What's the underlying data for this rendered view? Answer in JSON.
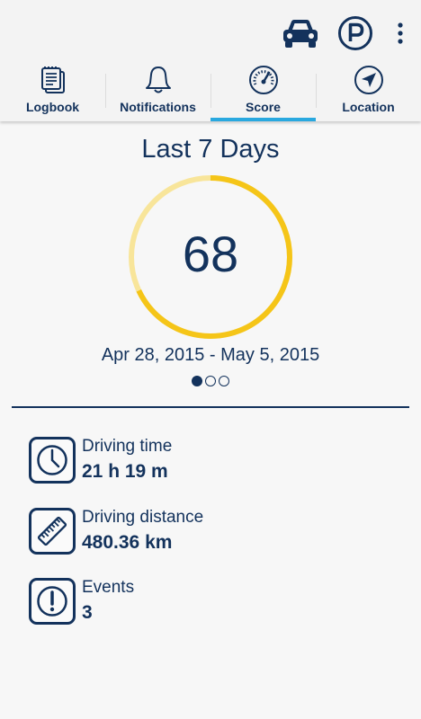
{
  "header": {
    "actions": [
      {
        "icon": "car-icon"
      },
      {
        "icon": "parking-icon"
      },
      {
        "icon": "more-vert-icon"
      }
    ]
  },
  "tabs": [
    {
      "label": "Logbook",
      "icon": "logbook-icon"
    },
    {
      "label": "Notifications",
      "icon": "bell-icon"
    },
    {
      "label": "Score",
      "icon": "speedometer-icon",
      "active": true
    },
    {
      "label": "Location",
      "icon": "navigation-arrow-icon"
    }
  ],
  "score": {
    "period_title": "Last 7 Days",
    "value": "68",
    "max": 100,
    "date_range": "Apr 28, 2015 - May 5, 2015",
    "page_index": 0,
    "page_count": 3
  },
  "stats": [
    {
      "label": "Driving time",
      "value": "21 h 19 m",
      "icon": "clock-icon"
    },
    {
      "label": "Driving distance",
      "value": "480.36 km",
      "icon": "ruler-icon"
    },
    {
      "label": "Events",
      "value": "3",
      "icon": "exclamation-icon"
    }
  ],
  "colors": {
    "primary": "#13325c",
    "accent": "#29a8df",
    "score_fill": "#f5c518",
    "score_track": "#f8e59a",
    "background": "#f7f7f7"
  }
}
